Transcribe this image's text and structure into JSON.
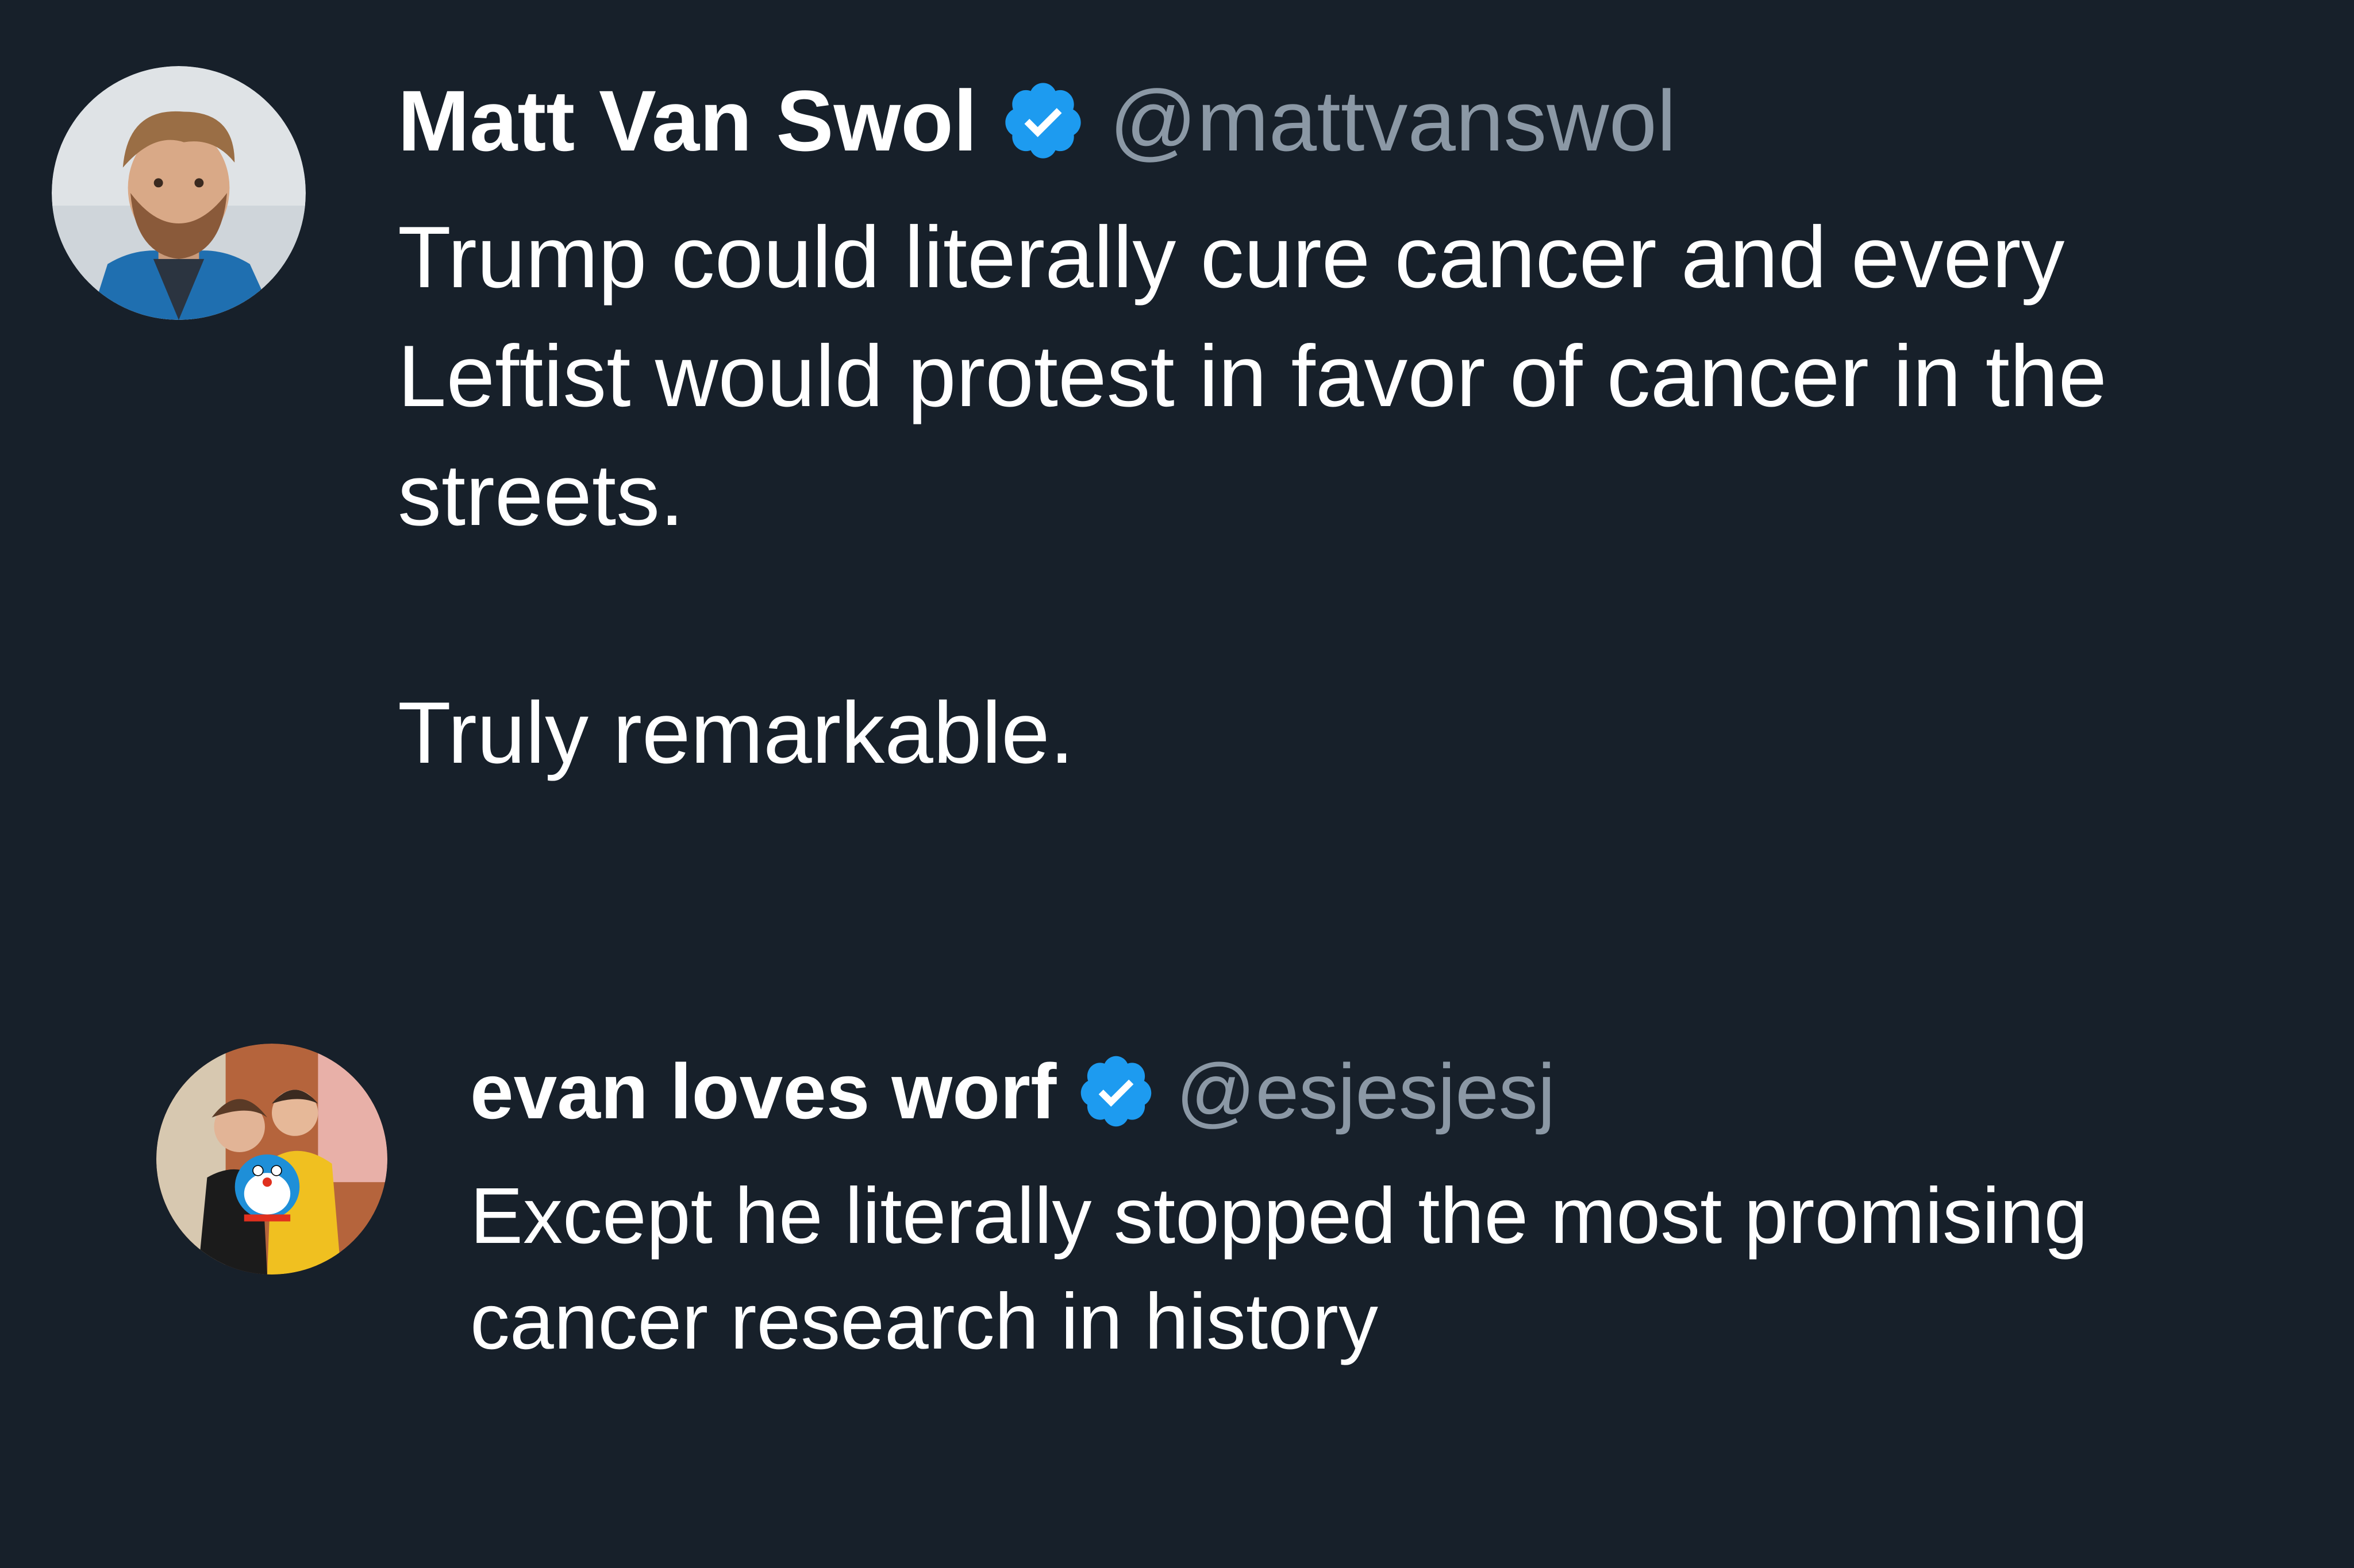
{
  "main_tweet": {
    "author_name": "Matt Van Swol",
    "handle": "@mattvanswol",
    "verified_icon": "verified-badge-icon",
    "text": "Trump could literally cure cancer and every Leftist would protest in favor of cancer in the streets.\n\nTruly remarkable."
  },
  "reply_tweet": {
    "author_name": "evan loves worf",
    "handle": "@esjesjesj",
    "verified_icon": "verified-badge-icon",
    "text": "Except he literally stopped the most promising cancer research in history"
  },
  "colors": {
    "background": "#17202a",
    "text": "#ffffff",
    "handle": "#8b98a5",
    "verified_badge": "#1d9bf0"
  }
}
